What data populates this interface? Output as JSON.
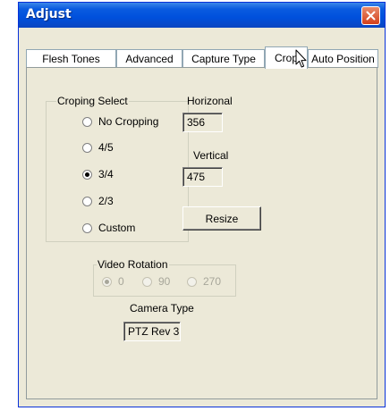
{
  "window": {
    "title": "Adjust"
  },
  "tabs": [
    {
      "label": "Flesh Tones"
    },
    {
      "label": "Advanced"
    },
    {
      "label": "Capture Type"
    },
    {
      "label": "Crop",
      "active": true
    },
    {
      "label": "Auto Position"
    }
  ],
  "crop": {
    "group_label": "Croping Select",
    "options": [
      {
        "label": "No Cropping",
        "checked": false
      },
      {
        "label": "4/5",
        "checked": false
      },
      {
        "label": "3/4",
        "checked": true
      },
      {
        "label": "2/3",
        "checked": false
      },
      {
        "label": "Custom",
        "checked": false
      }
    ],
    "horizontal_label": "Horizonal",
    "horizontal_value": "356",
    "vertical_label": "Vertical",
    "vertical_value": "475",
    "resize_label": "Resize"
  },
  "rotation": {
    "group_label": "Video Rotation",
    "options": [
      {
        "label": "0",
        "checked": true
      },
      {
        "label": "90",
        "checked": false
      },
      {
        "label": "270",
        "checked": false
      }
    ],
    "enabled": false
  },
  "camera": {
    "label": "Camera Type",
    "value": "PTZ Rev 3"
  },
  "colors": {
    "titlebar": "#0050dc",
    "dialog_bg": "#ece9d8",
    "close_button": "#d5401c"
  },
  "icons": {
    "close": "close-icon",
    "cursor": "mouse-pointer-icon"
  }
}
